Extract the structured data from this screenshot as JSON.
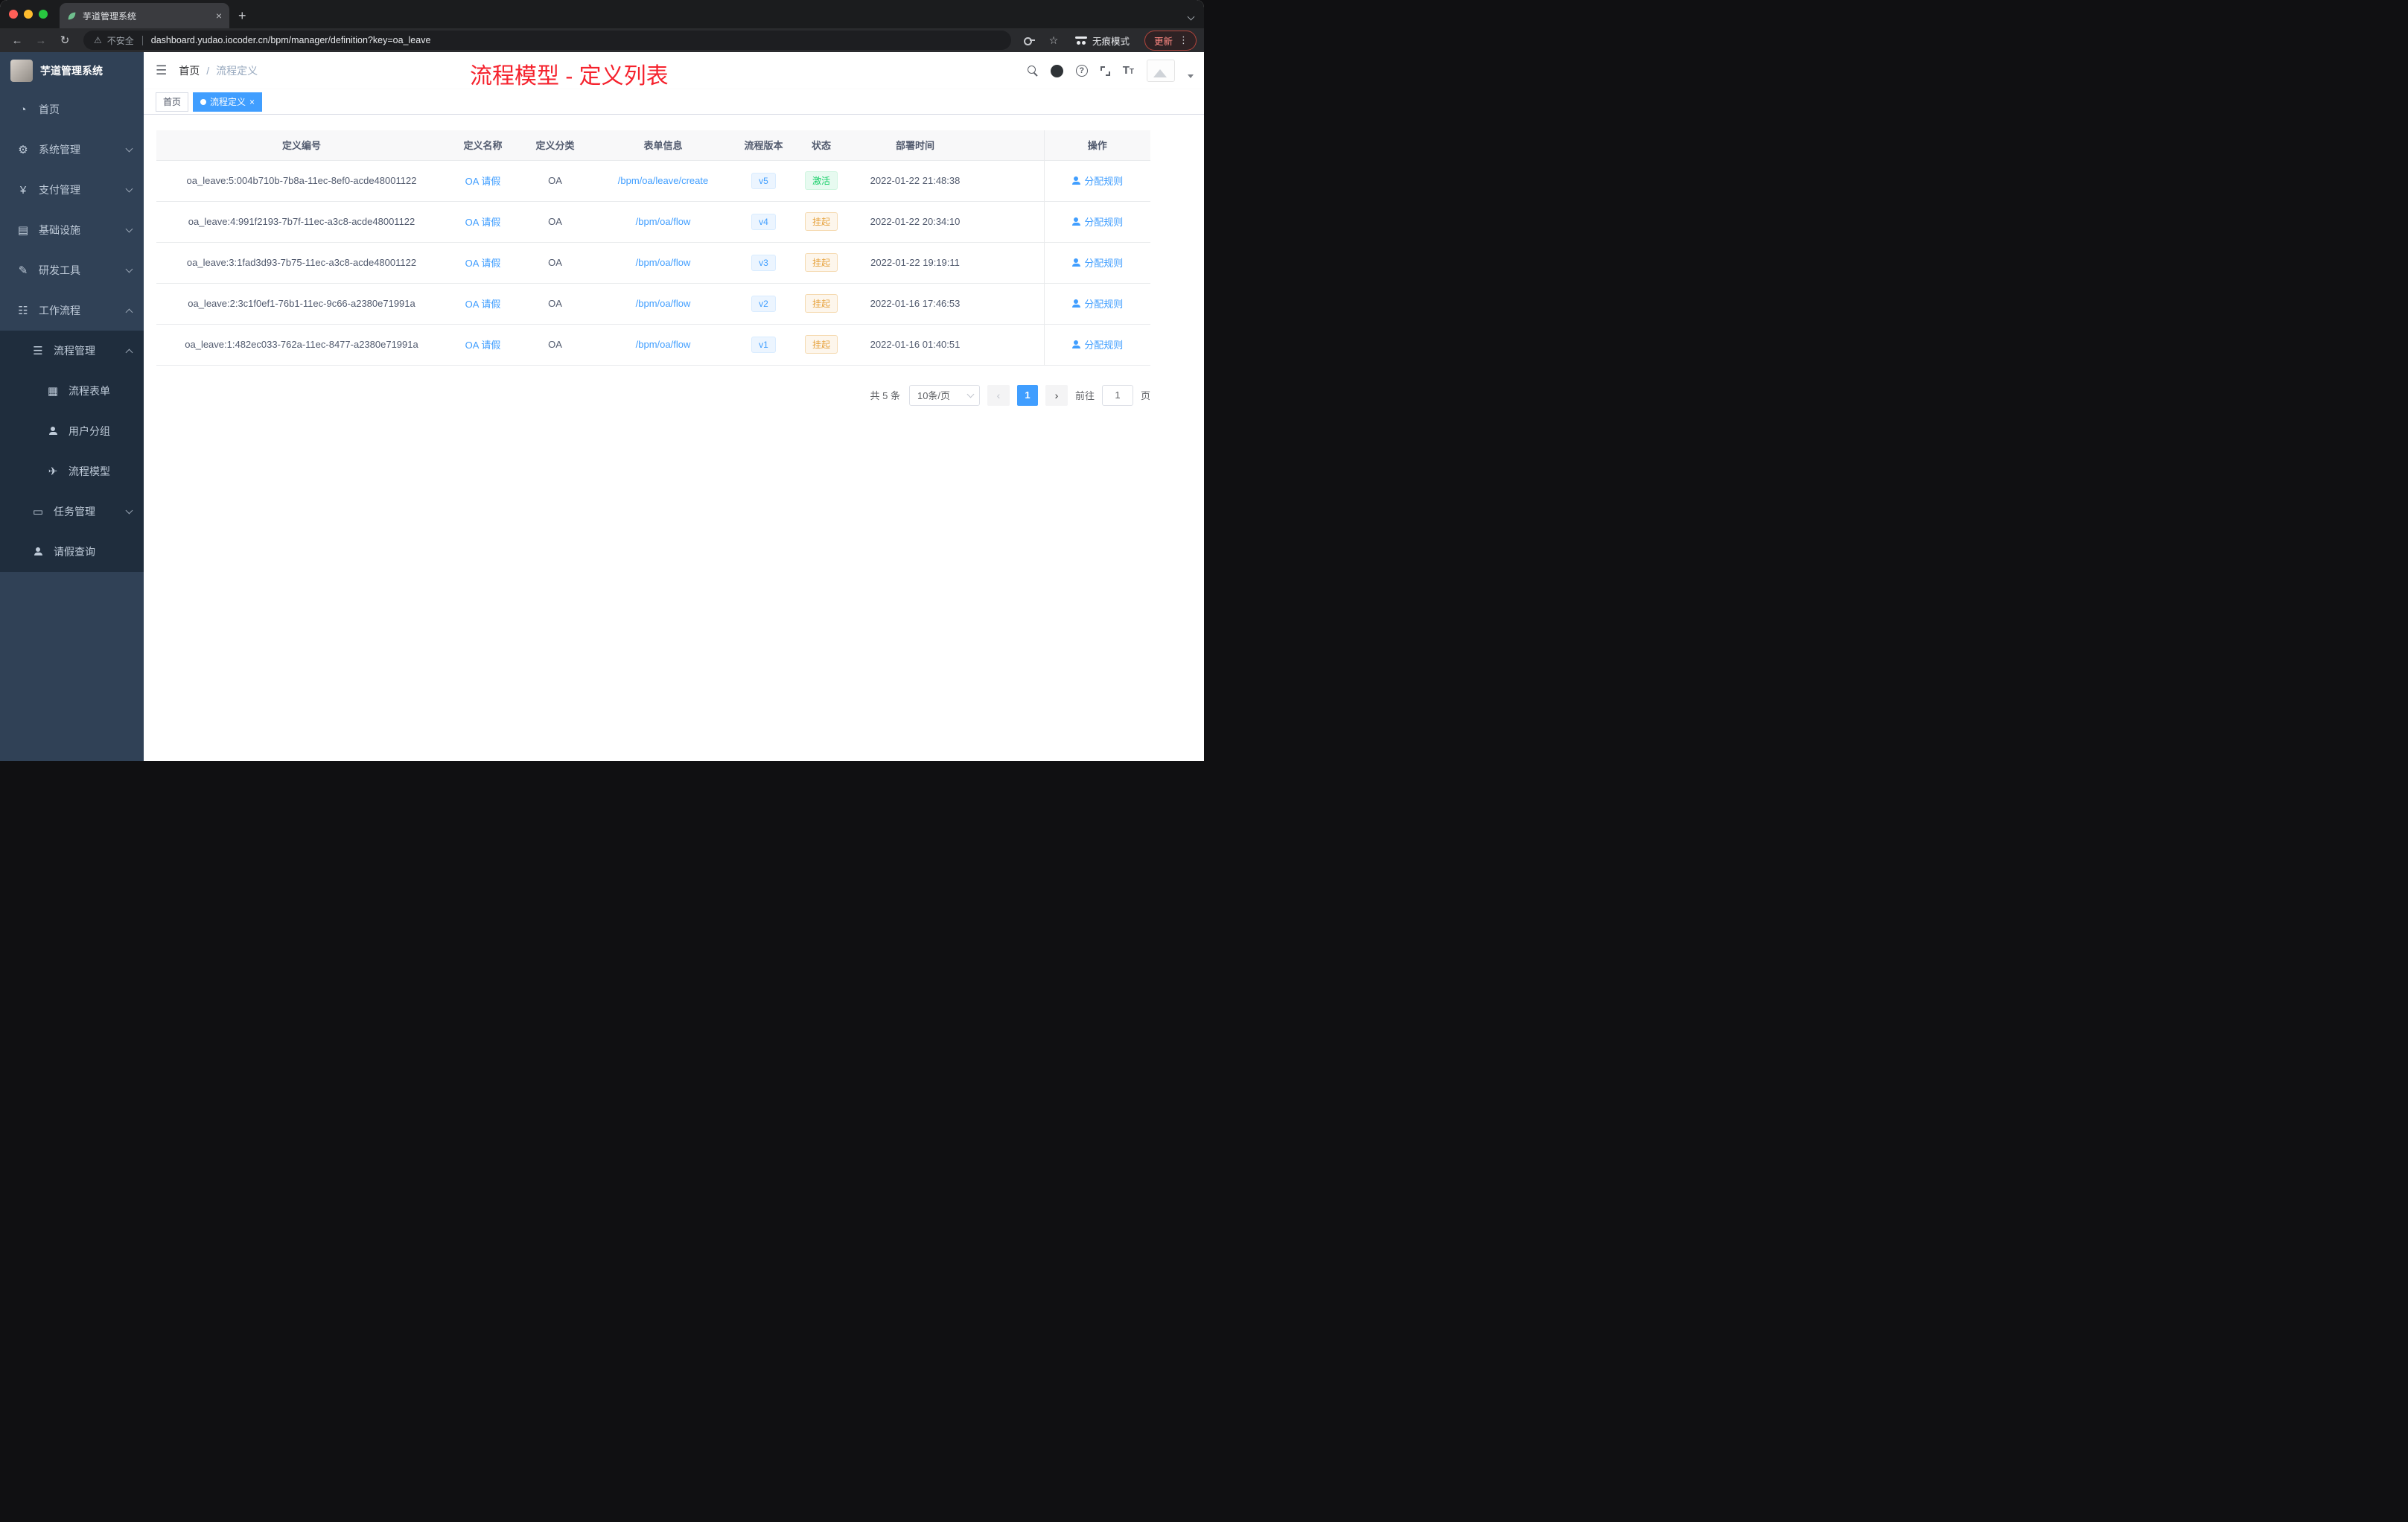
{
  "icons": {
    "hamburger": "☰",
    "warning": "⚠",
    "star": "☆",
    "back": "←",
    "forward": "→",
    "refresh": "↻",
    "plus": "+",
    "close": "×",
    "dots": "⋮",
    "question": "?",
    "dashboard": "◔",
    "gear": "⚙",
    "yen": "¥",
    "infra": "▤",
    "tools": "✎",
    "workflow": "☷",
    "process": "☰",
    "form": "▦",
    "model": "✈",
    "task": "▭",
    "prev": "‹",
    "next": "›"
  },
  "browser": {
    "tab_title": "芋道管理系统",
    "security_label": "不安全",
    "url": "dashboard.yudao.iocoder.cn/bpm/manager/definition?key=oa_leave",
    "incognito_label": "无痕模式",
    "update_label": "更新"
  },
  "sidebar": {
    "brand": "芋道管理系统",
    "items": [
      {
        "label": "首页"
      },
      {
        "label": "系统管理"
      },
      {
        "label": "支付管理"
      },
      {
        "label": "基础设施"
      },
      {
        "label": "研发工具"
      },
      {
        "label": "工作流程"
      },
      {
        "label": "流程管理"
      },
      {
        "label": "流程表单"
      },
      {
        "label": "用户分组"
      },
      {
        "label": "流程模型"
      },
      {
        "label": "任务管理"
      },
      {
        "label": "请假查询"
      }
    ]
  },
  "navbar": {
    "breadcrumb": {
      "home": "首页",
      "separator": "/",
      "current": "流程定义"
    },
    "annotation": "流程模型 - 定义列表"
  },
  "tags": {
    "home": "首页",
    "active": "流程定义"
  },
  "table": {
    "columns": [
      "定义编号",
      "定义名称",
      "定义分类",
      "表单信息",
      "流程版本",
      "状态",
      "部署时间",
      "操作"
    ],
    "rows": [
      {
        "id": "oa_leave:5:004b710b-7b8a-11ec-8ef0-acde48001122",
        "name": "OA 请假",
        "category": "OA",
        "form": "/bpm/oa/leave/create",
        "version": "v5",
        "status": "激活",
        "time": "2022-01-22 21:48:38",
        "action": "分配规则"
      },
      {
        "id": "oa_leave:4:991f2193-7b7f-11ec-a3c8-acde48001122",
        "name": "OA 请假",
        "category": "OA",
        "form": "/bpm/oa/flow",
        "version": "v4",
        "status": "挂起",
        "time": "2022-01-22 20:34:10",
        "action": "分配规则"
      },
      {
        "id": "oa_leave:3:1fad3d93-7b75-11ec-a3c8-acde48001122",
        "name": "OA 请假",
        "category": "OA",
        "form": "/bpm/oa/flow",
        "version": "v3",
        "status": "挂起",
        "time": "2022-01-22 19:19:11",
        "action": "分配规则"
      },
      {
        "id": "oa_leave:2:3c1f0ef1-76b1-11ec-9c66-a2380e71991a",
        "name": "OA 请假",
        "category": "OA",
        "form": "/bpm/oa/flow",
        "version": "v2",
        "status": "挂起",
        "time": "2022-01-16 17:46:53",
        "action": "分配规则"
      },
      {
        "id": "oa_leave:1:482ec033-762a-11ec-8477-a2380e71991a",
        "name": "OA 请假",
        "category": "OA",
        "form": "/bpm/oa/flow",
        "version": "v1",
        "status": "挂起",
        "time": "2022-01-16 01:40:51",
        "action": "分配规则"
      }
    ]
  },
  "pagination": {
    "total": "共 5 条",
    "page_size": "10条/页",
    "page": "1",
    "goto_label": "前往",
    "goto_value": "1",
    "goto_unit": "页"
  },
  "colors": {
    "primary": "#409eff",
    "success": "#13ce66",
    "warning": "#e6a23c",
    "annotation": "#f5222d",
    "sidebar": "#304156",
    "submenu": "#1f2d3d"
  }
}
